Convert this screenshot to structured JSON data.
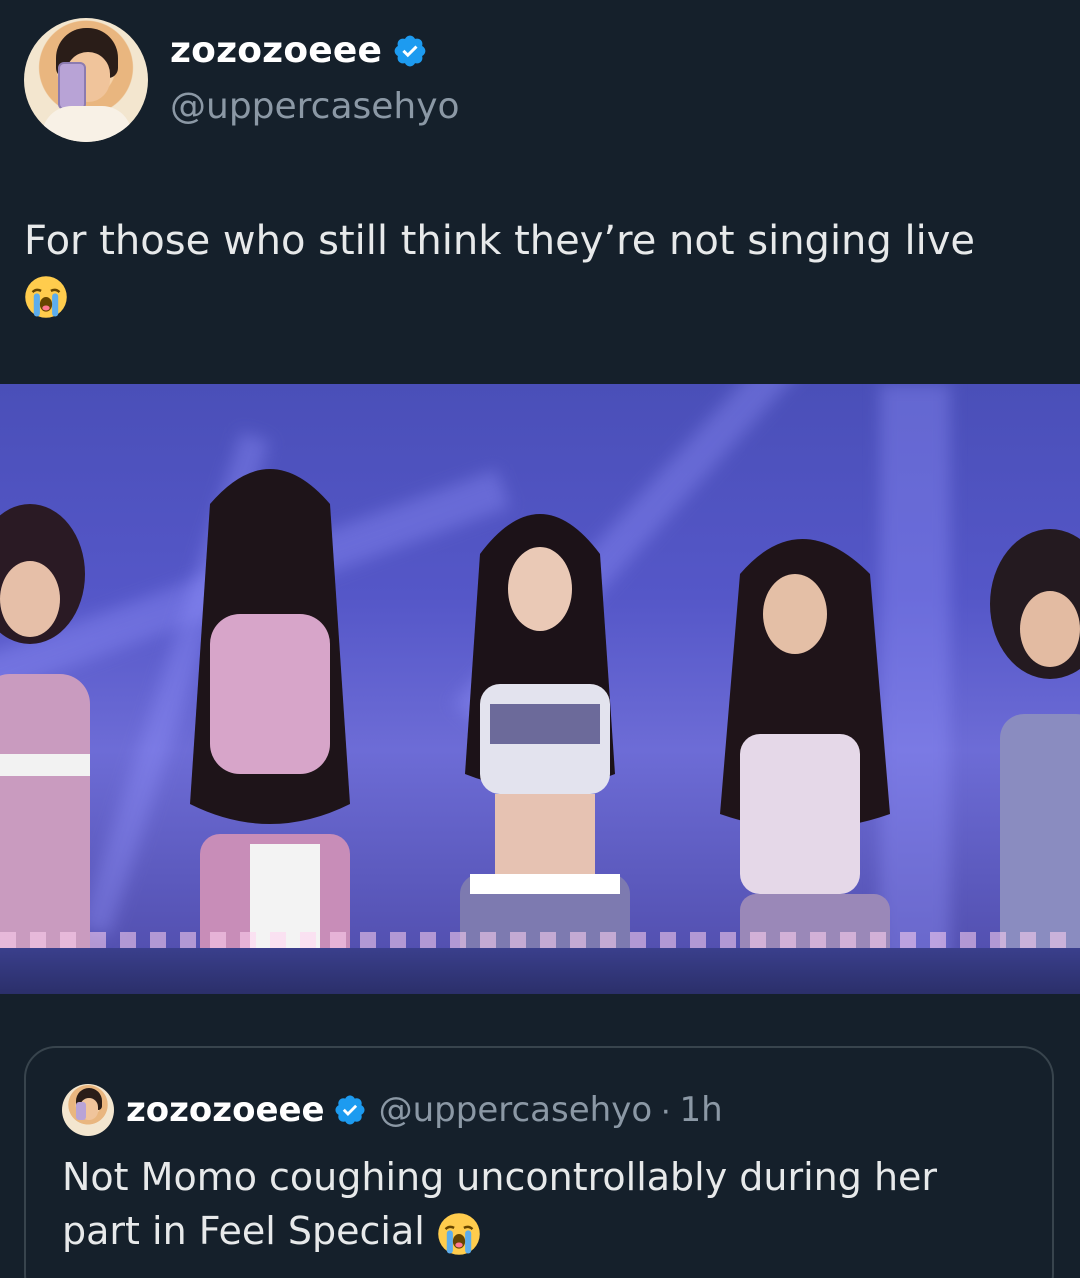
{
  "tweet": {
    "display_name": "zozozoeee",
    "handle": "@uppercasehyo",
    "verified": true,
    "text": "For those who still think they’re not singing live",
    "emoji": "loudly-crying-face"
  },
  "media": {
    "type": "video-still"
  },
  "quoted_tweet": {
    "display_name": "zozozoeee",
    "handle": "@uppercasehyo",
    "separator": "·",
    "time": "1h",
    "verified": true,
    "text": "Not Momo coughing uncontrollably during her part in Feel Special",
    "emoji": "loudly-crying-face"
  },
  "colors": {
    "background": "#15202b",
    "text_primary": "#e7e9ea",
    "text_secondary": "#8b98a5",
    "verified_blue": "#1d9bf0",
    "border": "#38444d"
  }
}
